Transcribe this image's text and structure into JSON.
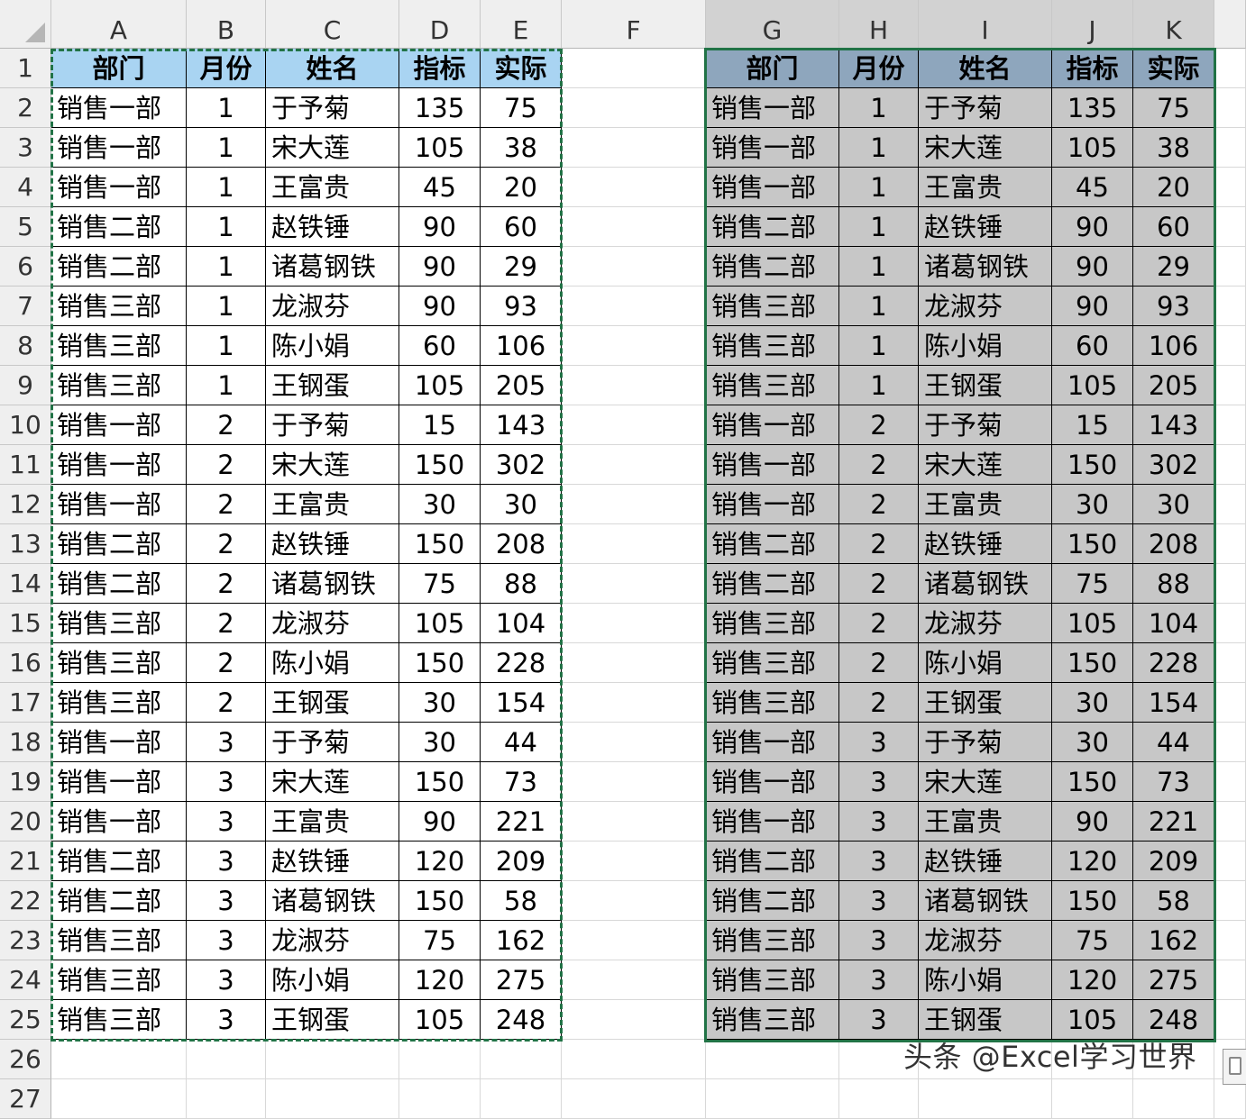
{
  "sheet": {
    "columns": [
      "A",
      "B",
      "C",
      "D",
      "E",
      "F",
      "G",
      "H",
      "I",
      "J",
      "K"
    ],
    "selected_columns": [
      "G",
      "H",
      "I",
      "J",
      "K"
    ],
    "rows": [
      "1",
      "2",
      "3",
      "4",
      "5",
      "6",
      "7",
      "8",
      "9",
      "10",
      "11",
      "12",
      "13",
      "14",
      "15",
      "16",
      "17",
      "18",
      "19",
      "20",
      "21",
      "22",
      "23",
      "24",
      "25",
      "26",
      "27"
    ]
  },
  "table": {
    "headers": [
      "部门",
      "月份",
      "姓名",
      "指标",
      "实际"
    ],
    "rows": [
      [
        "销售一部",
        "1",
        "于予菊",
        "135",
        "75"
      ],
      [
        "销售一部",
        "1",
        "宋大莲",
        "105",
        "38"
      ],
      [
        "销售一部",
        "1",
        "王富贵",
        "45",
        "20"
      ],
      [
        "销售二部",
        "1",
        "赵铁锤",
        "90",
        "60"
      ],
      [
        "销售二部",
        "1",
        "诸葛钢铁",
        "90",
        "29"
      ],
      [
        "销售三部",
        "1",
        "龙淑芬",
        "90",
        "93"
      ],
      [
        "销售三部",
        "1",
        "陈小娟",
        "60",
        "106"
      ],
      [
        "销售三部",
        "1",
        "王钢蛋",
        "105",
        "205"
      ],
      [
        "销售一部",
        "2",
        "于予菊",
        "15",
        "143"
      ],
      [
        "销售一部",
        "2",
        "宋大莲",
        "150",
        "302"
      ],
      [
        "销售一部",
        "2",
        "王富贵",
        "30",
        "30"
      ],
      [
        "销售二部",
        "2",
        "赵铁锤",
        "150",
        "208"
      ],
      [
        "销售二部",
        "2",
        "诸葛钢铁",
        "75",
        "88"
      ],
      [
        "销售三部",
        "2",
        "龙淑芬",
        "105",
        "104"
      ],
      [
        "销售三部",
        "2",
        "陈小娟",
        "150",
        "228"
      ],
      [
        "销售三部",
        "2",
        "王钢蛋",
        "30",
        "154"
      ],
      [
        "销售一部",
        "3",
        "于予菊",
        "30",
        "44"
      ],
      [
        "销售一部",
        "3",
        "宋大莲",
        "150",
        "73"
      ],
      [
        "销售一部",
        "3",
        "王富贵",
        "90",
        "221"
      ],
      [
        "销售二部",
        "3",
        "赵铁锤",
        "120",
        "209"
      ],
      [
        "销售二部",
        "3",
        "诸葛钢铁",
        "150",
        "58"
      ],
      [
        "销售三部",
        "3",
        "龙淑芬",
        "75",
        "162"
      ],
      [
        "销售三部",
        "3",
        "陈小娟",
        "120",
        "275"
      ],
      [
        "销售三部",
        "3",
        "王钢蛋",
        "105",
        "248"
      ]
    ]
  },
  "watermark": "头条 @Excel学习世界",
  "colors": {
    "source_header_fill": "#a9d4f2",
    "pasted_header_fill": "#8ea6bd",
    "pasted_data_fill": "#c7c7c7",
    "selection_border": "#217346"
  },
  "icons": {
    "paste_options": "paste-options-icon"
  }
}
